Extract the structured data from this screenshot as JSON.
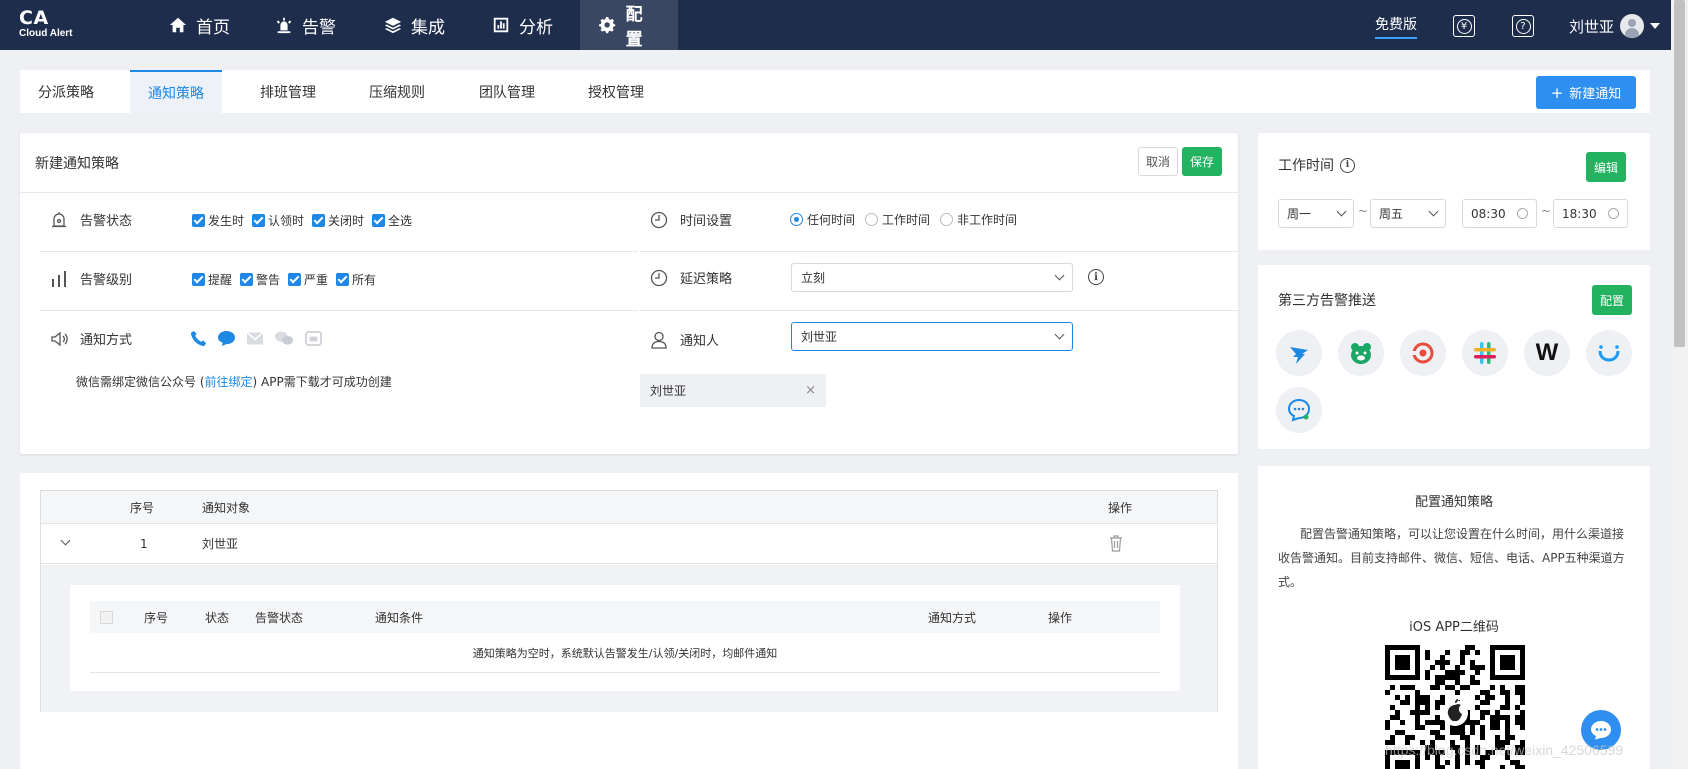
{
  "logo": {
    "big": "CA",
    "small": "Cloud Alert"
  },
  "nav": [
    {
      "label": "首页",
      "icon": "home-icon"
    },
    {
      "label": "告警",
      "icon": "siren-icon"
    },
    {
      "label": "集成",
      "icon": "layers-icon"
    },
    {
      "label": "分析",
      "icon": "bar-chart-icon"
    },
    {
      "label": "配置",
      "icon": "gear-icon",
      "active": true
    }
  ],
  "top_right": {
    "plan": "免费版",
    "yen_icon": "¥",
    "help_icon": "?",
    "user": "刘世亚"
  },
  "tabs": [
    "分派策略",
    "通知策略",
    "排班管理",
    "压缩规则",
    "团队管理",
    "授权管理"
  ],
  "active_tab": "通知策略",
  "new_button": "新建通知",
  "form": {
    "title": "新建通知策略",
    "cancel": "取消",
    "save": "保存",
    "alert_status": {
      "label": "告警状态",
      "options": [
        "发生时",
        "认领时",
        "关闭时",
        "全选"
      ]
    },
    "alert_level": {
      "label": "告警级别",
      "options": [
        "提醒",
        "警告",
        "严重",
        "所有"
      ]
    },
    "notify_method": {
      "label": "通知方式"
    },
    "note_pre": "微信需绑定微信公众号 (",
    "note_link": "前往绑定",
    "note_post": ") APP需下载才可成功创建",
    "time_setting": {
      "label": "时间设置",
      "options": [
        "任何时间",
        "工作时间",
        "非工作时间"
      ],
      "selected": "任何时间"
    },
    "delay": {
      "label": "延迟策略",
      "value": "立刻"
    },
    "notifier": {
      "label": "通知人",
      "value": "刘世亚",
      "chip": "刘世亚",
      "chip_close": "×"
    }
  },
  "table": {
    "headers": {
      "seq": "序号",
      "target": "通知对象",
      "op": "操作"
    },
    "row": {
      "seq": "1",
      "target": "刘世亚"
    },
    "inner_headers": {
      "seq": "序号",
      "status": "状态",
      "alert_status": "告警状态",
      "cond": "通知条件",
      "method": "通知方式",
      "op": "操作"
    },
    "inner_empty": "通知策略为空时，系统默认告警发生/认领/关闭时，均邮件通知"
  },
  "work_time": {
    "title": "工作时间",
    "edit": "编辑",
    "day_from": "周一",
    "day_to": "周五",
    "time_from": "08:30",
    "time_to": "18:30",
    "sep": "~"
  },
  "third_party": {
    "title": "第三方告警推送",
    "config": "配置",
    "icons": [
      "dingtalk-icon",
      "bear-icon",
      "ring-icon",
      "slack-icon",
      "w-icon",
      "smile-icon",
      "chat-bubble-icon"
    ],
    "w_letter": "W"
  },
  "help": {
    "title": "配置通知策略",
    "desc": "配置告警通知策略，可以让您设置在什么时间，用什么渠道接收告警通知。目前支持邮件、微信、短信、电话、APP五种渠道方式。",
    "qr_title": "iOS APP二维码"
  },
  "watermark": "https://blog.csdn.net/weixin_42506599"
}
